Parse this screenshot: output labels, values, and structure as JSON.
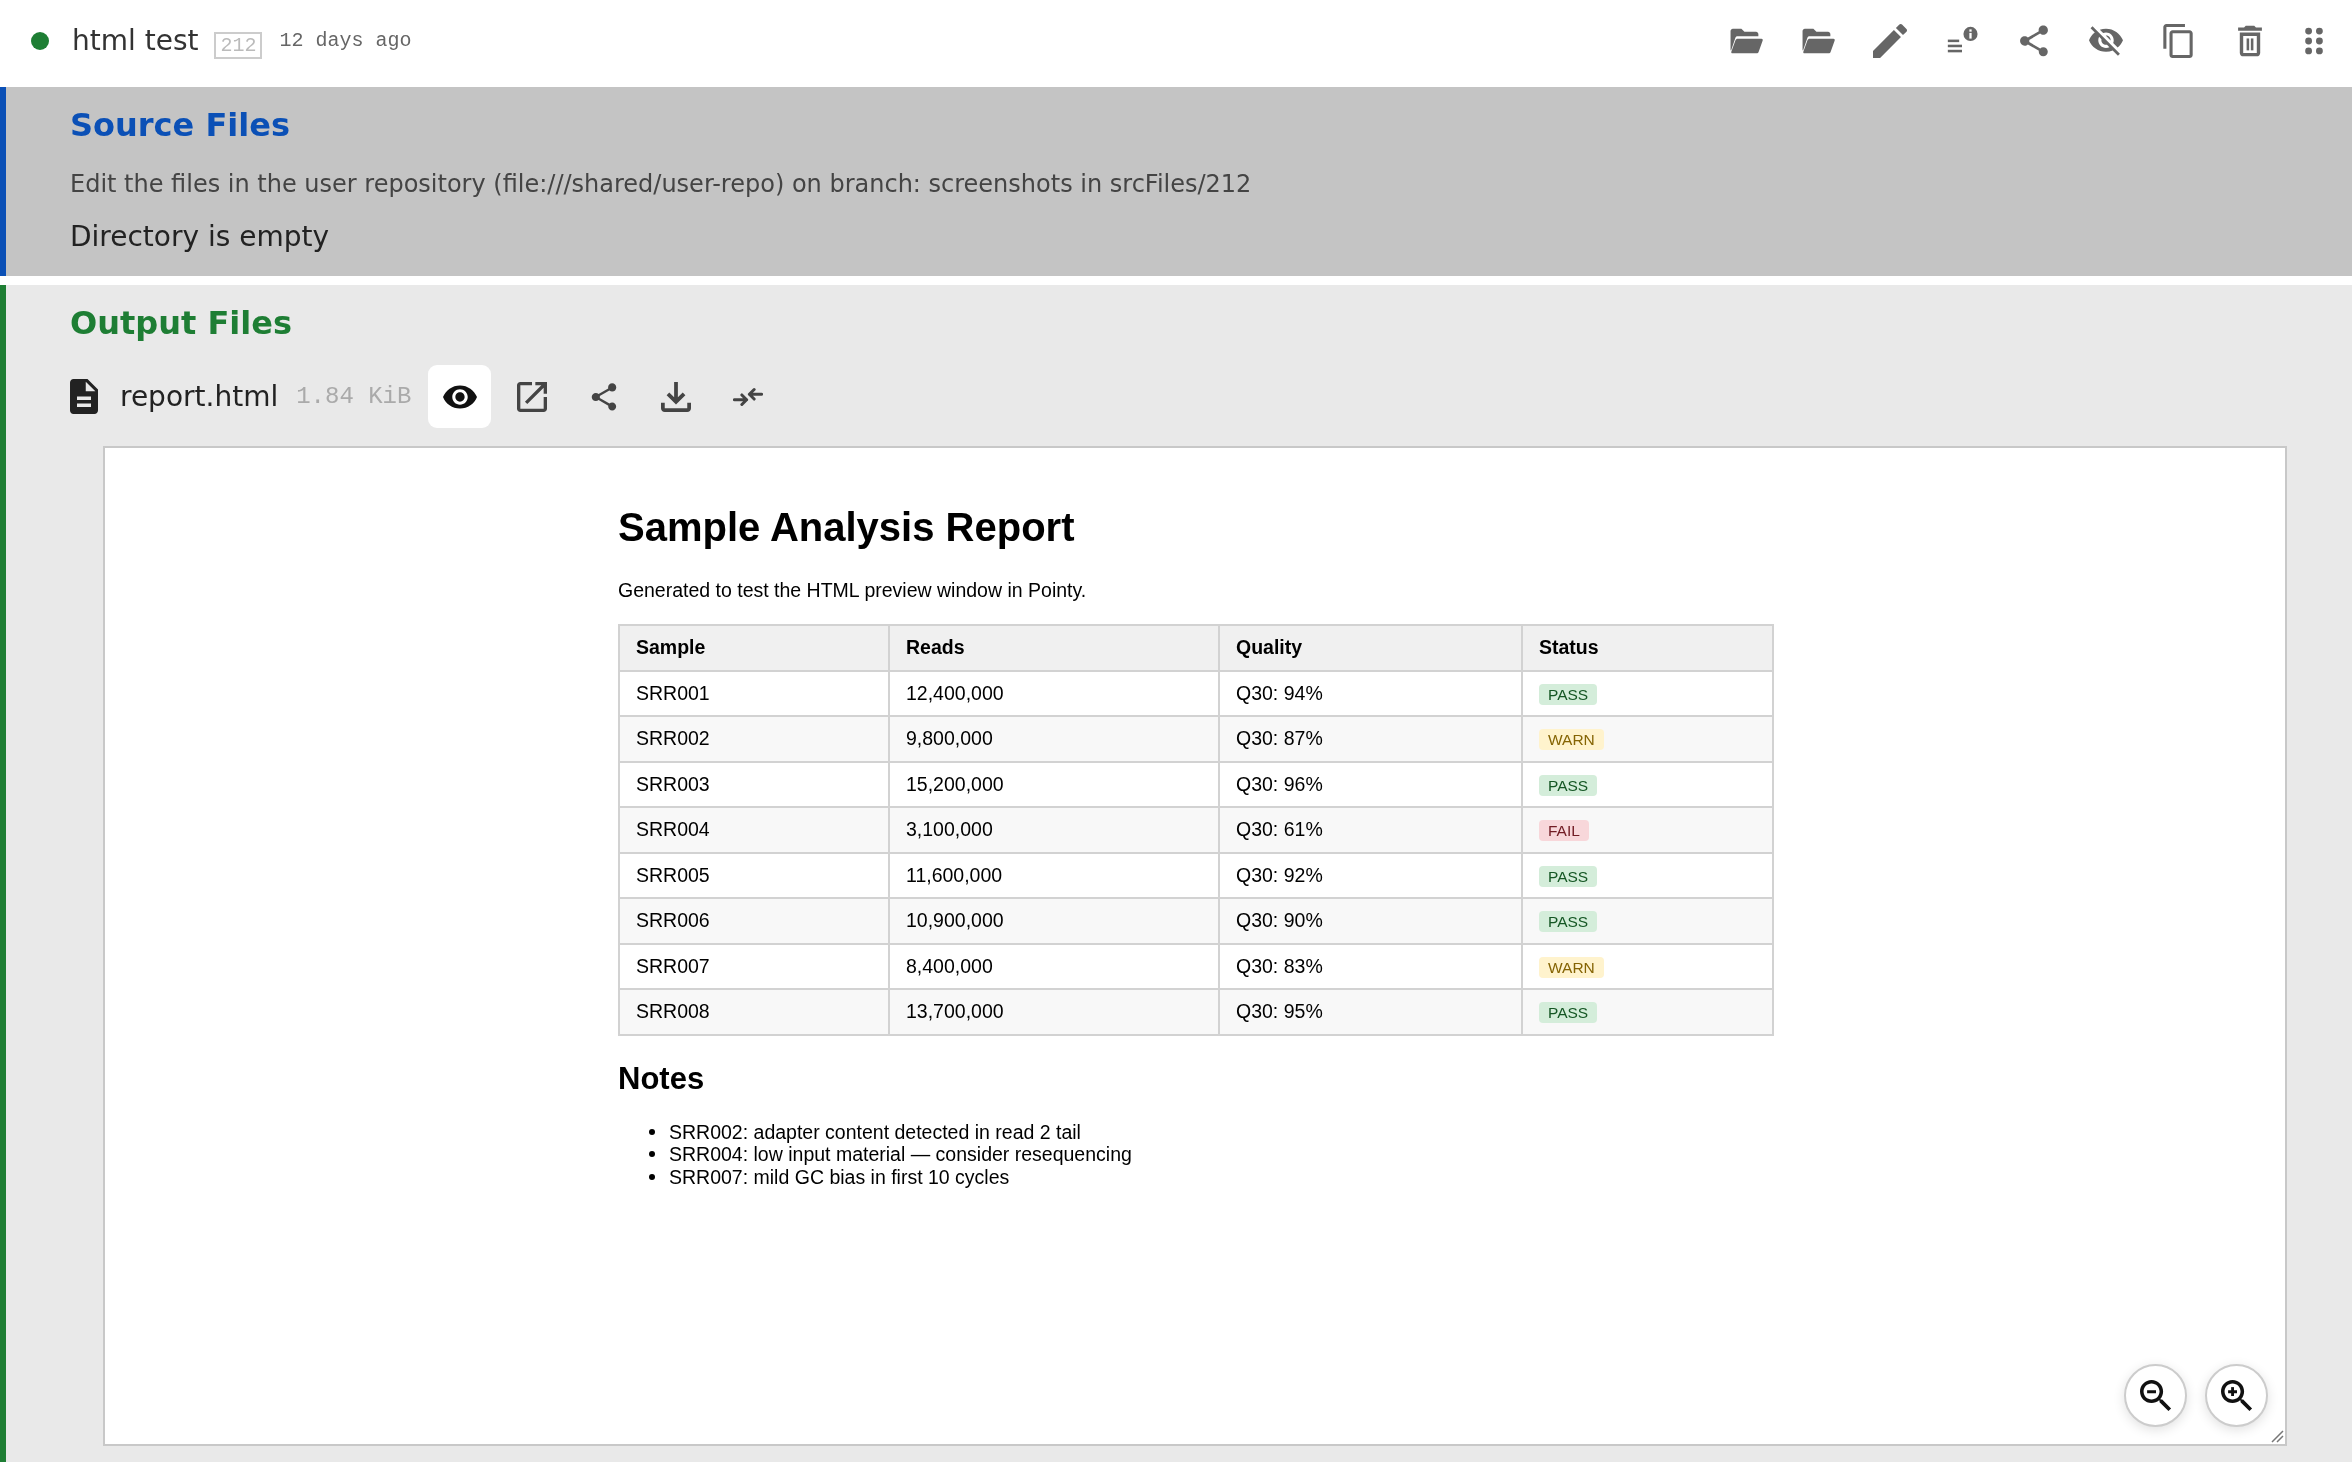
{
  "header": {
    "status_dot": {
      "color": "#1e7e34"
    },
    "title": "html test",
    "id_badge": "212",
    "age": "12 days ago"
  },
  "source_files": {
    "title": "Source Files",
    "description": "Edit the files in the user repository (file:///shared/user-repo) on branch: screenshots in srcFiles/212",
    "empty_message": "Directory is empty"
  },
  "output_files": {
    "title": "Output Files",
    "files": [
      {
        "name": "report.html",
        "size": "1.84 KiB",
        "preview_open": true,
        "preview": {
          "title": "Sample Analysis Report",
          "intro": "Generated to test the HTML preview window in Pointy.",
          "table": {
            "columns": [
              "Sample",
              "Reads",
              "Quality",
              "Status"
            ],
            "rows": [
              {
                "cells": [
                  "SRR001",
                  "12,400,000",
                  "Q30: 94%"
                ],
                "status": {
                  "label": "PASS",
                  "kind": "pass"
                }
              },
              {
                "cells": [
                  "SRR002",
                  "9,800,000",
                  "Q30: 87%"
                ],
                "status": {
                  "label": "WARN",
                  "kind": "warn"
                }
              },
              {
                "cells": [
                  "SRR003",
                  "15,200,000",
                  "Q30: 96%"
                ],
                "status": {
                  "label": "PASS",
                  "kind": "pass"
                }
              },
              {
                "cells": [
                  "SRR004",
                  "3,100,000",
                  "Q30: 61%"
                ],
                "status": {
                  "label": "FAIL",
                  "kind": "fail"
                }
              },
              {
                "cells": [
                  "SRR005",
                  "11,600,000",
                  "Q30: 92%"
                ],
                "status": {
                  "label": "PASS",
                  "kind": "pass"
                }
              },
              {
                "cells": [
                  "SRR006",
                  "10,900,000",
                  "Q30: 90%"
                ],
                "status": {
                  "label": "PASS",
                  "kind": "pass"
                }
              },
              {
                "cells": [
                  "SRR007",
                  "8,400,000",
                  "Q30: 83%"
                ],
                "status": {
                  "label": "WARN",
                  "kind": "warn"
                }
              },
              {
                "cells": [
                  "SRR008",
                  "13,700,000",
                  "Q30: 95%"
                ],
                "status": {
                  "label": "PASS",
                  "kind": "pass"
                }
              }
            ]
          },
          "notes_title": "Notes",
          "notes": [
            "SRR002: adapter content detected in read 2 tail",
            "SRR004: low input material — consider resequencing",
            "SRR007: mild GC bias in first 10 cycles"
          ]
        }
      }
    ]
  }
}
